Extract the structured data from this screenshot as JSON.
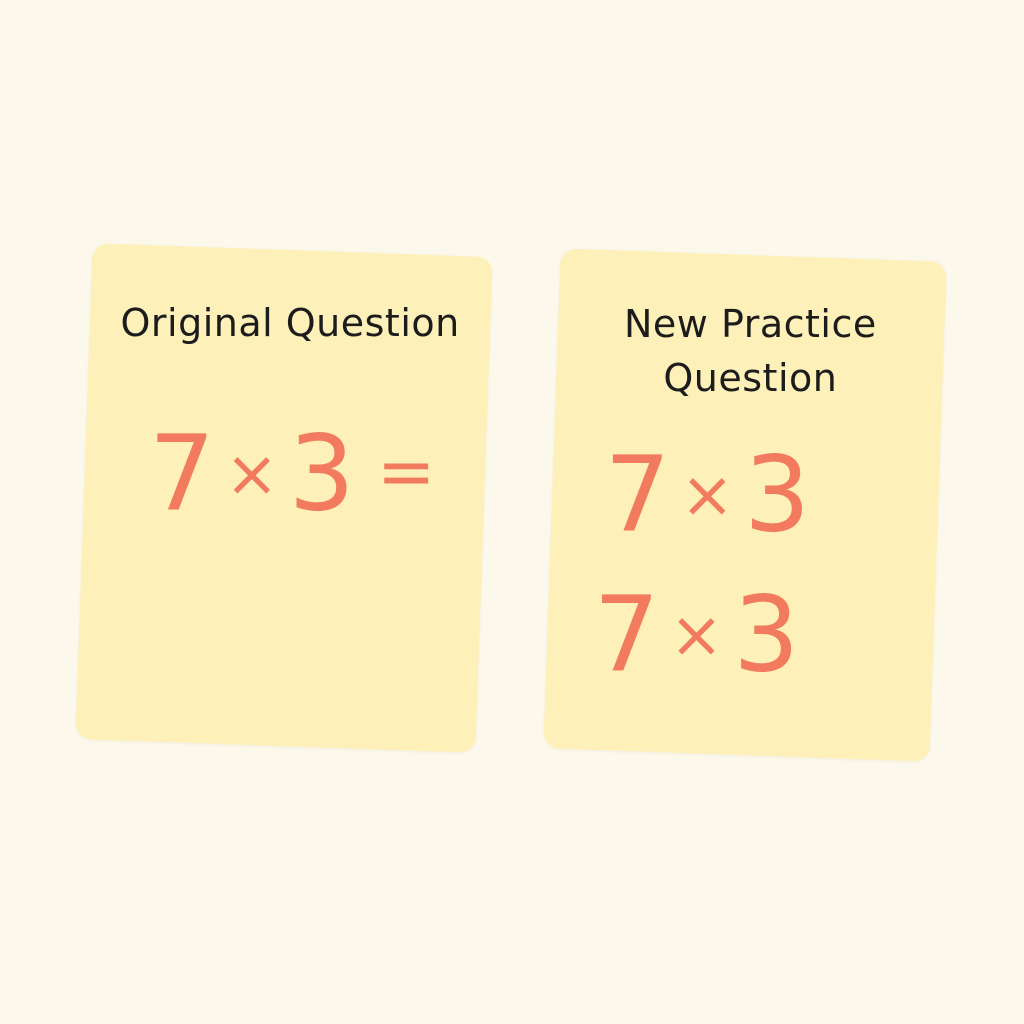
{
  "colors": {
    "background": "#fcf8ec",
    "card": "#fdf0b8",
    "ink": "#f27a5e",
    "title_text": "#1c1c1c"
  },
  "original_card": {
    "title": "Original Question",
    "expression": {
      "left": "7",
      "operator": "×",
      "right": "3",
      "equals": "="
    }
  },
  "practice_card": {
    "title_lines": [
      "New Practice",
      "Question"
    ],
    "expressions": [
      {
        "left": "7",
        "operator": "×",
        "right": "3"
      },
      {
        "left": "7",
        "operator": "×",
        "right": "3"
      }
    ]
  }
}
